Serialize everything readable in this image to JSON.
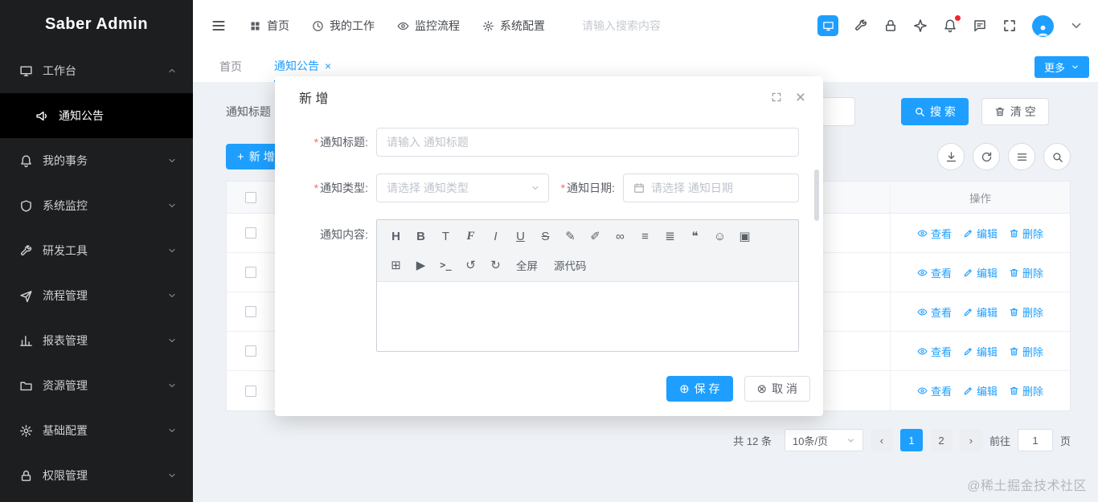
{
  "colors": {
    "accent": "#1e9fff",
    "sidebar_bg": "#1d1e20",
    "sidebar_active_bg": "#000000",
    "danger": "#f56c6c"
  },
  "icons": {
    "plus": "+",
    "caret_down": "▾",
    "close": "×",
    "save": "⊕",
    "cancel": "⊗",
    "prev": "‹",
    "next": "›",
    "asterisk": "*"
  },
  "sidebar": {
    "logo_text": "Saber Admin",
    "items": [
      {
        "label": "工作台",
        "icon": "monitor-icon",
        "state": "expanded"
      },
      {
        "label": "通知公告",
        "icon": "megaphone-icon",
        "state": "active"
      },
      {
        "label": "我的事务",
        "icon": "bell-icon",
        "state": "collapsed"
      },
      {
        "label": "系统监控",
        "icon": "shield-icon",
        "state": "collapsed"
      },
      {
        "label": "研发工具",
        "icon": "wrench-icon",
        "state": "collapsed"
      },
      {
        "label": "流程管理",
        "icon": "send-icon",
        "state": "collapsed"
      },
      {
        "label": "报表管理",
        "icon": "chart-icon",
        "state": "collapsed"
      },
      {
        "label": "资源管理",
        "icon": "folder-icon",
        "state": "collapsed"
      },
      {
        "label": "基础配置",
        "icon": "gear-icon",
        "state": "collapsed"
      },
      {
        "label": "权限管理",
        "icon": "lock-icon",
        "state": "collapsed"
      }
    ]
  },
  "header": {
    "nav": [
      {
        "label": "首页",
        "icon": "grid-icon"
      },
      {
        "label": "我的工作",
        "icon": "clock-icon"
      },
      {
        "label": "监控流程",
        "icon": "eye-icon"
      },
      {
        "label": "系统配置",
        "icon": "gear-icon"
      }
    ],
    "search_placeholder": "请输入搜索内容",
    "right_icons": [
      "monitor-badge-icon",
      "tools-icon",
      "lock-icon",
      "star-icon",
      "bell-icon",
      "message-icon",
      "fullscreen-icon",
      "avatar",
      "caret-down-icon"
    ]
  },
  "tabs": {
    "items": [
      {
        "label": "首页",
        "active": false
      },
      {
        "label": "通知公告",
        "active": true,
        "closable": true
      }
    ],
    "more_label": "更多"
  },
  "filter": {
    "label": "通知标题",
    "search_button": "搜 索",
    "clear_button": "清 空"
  },
  "toolbar": {
    "add_button": "新 增",
    "icon_buttons": [
      "download-icon",
      "refresh-icon",
      "column-settings-icon",
      "search-icon"
    ]
  },
  "table": {
    "ops_header": "操作",
    "actions": {
      "view": "查看",
      "edit": "编辑",
      "delete": "删除"
    },
    "visible_row_count": 5
  },
  "pagination": {
    "total": "共 12 条",
    "page_size": "10条/页",
    "pages": [
      "1",
      "2"
    ],
    "active_page": "1",
    "goto_label": "前往",
    "goto_value": "1",
    "goto_unit": "页"
  },
  "modal": {
    "title": "新 增",
    "fields": {
      "title": {
        "label": "通知标题:",
        "required": true,
        "placeholder": "请输入 通知标题"
      },
      "type": {
        "label": "通知类型:",
        "required": true,
        "placeholder": "请选择 通知类型"
      },
      "date": {
        "label": "通知日期:",
        "required": true,
        "placeholder": "请选择 通知日期"
      },
      "content": {
        "label": "通知内容:",
        "required": false
      }
    },
    "editor": {
      "row1": [
        {
          "name": "heading-icon",
          "glyph": "H"
        },
        {
          "name": "bold-icon",
          "glyph": "B"
        },
        {
          "name": "font-size-icon",
          "glyph": "T"
        },
        {
          "name": "font-family-icon",
          "glyph": "F"
        },
        {
          "name": "italic-icon",
          "glyph": "I"
        },
        {
          "name": "underline-icon",
          "glyph": "U"
        },
        {
          "name": "strikethrough-icon",
          "glyph": "S"
        },
        {
          "name": "text-color-icon",
          "glyph": "✎"
        },
        {
          "name": "highlight-icon",
          "glyph": "✐"
        },
        {
          "name": "link-icon",
          "glyph": "∞"
        },
        {
          "name": "list-icon",
          "glyph": "≡"
        },
        {
          "name": "justify-icon",
          "glyph": "≣"
        },
        {
          "name": "quote-icon",
          "glyph": "❝"
        },
        {
          "name": "emoji-icon",
          "glyph": "☺"
        },
        {
          "name": "image-icon",
          "glyph": "▣"
        }
      ],
      "row2": [
        {
          "name": "table-icon",
          "glyph": "⊞"
        },
        {
          "name": "video-icon",
          "glyph": "▶"
        },
        {
          "name": "code-icon",
          "glyph": ">_"
        },
        {
          "name": "undo-icon",
          "glyph": "↺"
        },
        {
          "name": "redo-icon",
          "glyph": "↻"
        },
        {
          "name": "fullscreen-button",
          "glyph": "全屏"
        },
        {
          "name": "source-code-button",
          "glyph": "源代码"
        }
      ]
    },
    "save_button": "保 存",
    "cancel_button": "取 消"
  },
  "watermark": "@稀土掘金技术社区"
}
